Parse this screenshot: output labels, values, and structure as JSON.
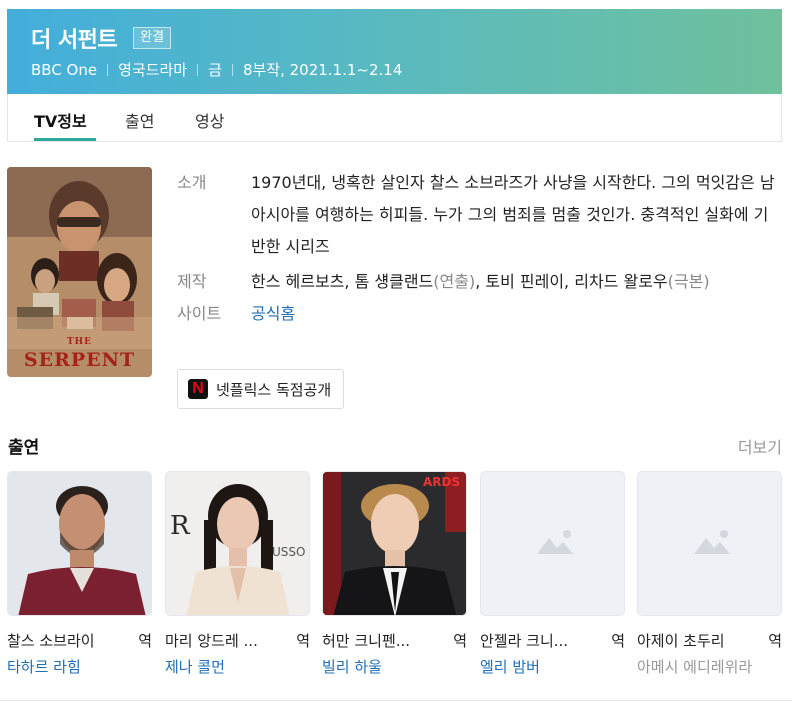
{
  "header": {
    "title": "더 서펀트",
    "badge": "완결",
    "meta": [
      "BBC One",
      "영국드라마",
      "금",
      "8부작, 2021.1.1~2.14"
    ]
  },
  "tabs": [
    {
      "label": "TV정보",
      "active": true
    },
    {
      "label": "출연",
      "active": false
    },
    {
      "label": "영상",
      "active": false
    }
  ],
  "poster": {
    "title_small": "THE",
    "title": "SERPENT"
  },
  "info": {
    "intro_label": "소개",
    "intro": "1970년대, 냉혹한 살인자 찰스 소브라즈가 사냥을 시작한다. 그의 먹잇감은 남아시아를 여행하는 히피들. 누가 그의 범죄를 멈출 것인가. 충격적인 실화에 기반한 시리즈",
    "production_label": "제작",
    "production_directors": "한스 헤르보츠, 톰 섕클랜드",
    "production_directors_role": "(연출)",
    "production_sep": ", ",
    "production_writers": "토비 핀레이, 리차드 왈로우",
    "production_writers_role": "(극본)",
    "site_label": "사이트",
    "site_link": "공식홈"
  },
  "netflix": {
    "logo": "N",
    "label": "넷플릭스 독점공개"
  },
  "cast_section": {
    "title": "출연",
    "more": "더보기"
  },
  "cast": [
    {
      "role": "찰스 소브라이",
      "role_suffix": "역",
      "name": "타하르 라힘",
      "has_photo": true,
      "linked": true
    },
    {
      "role": "마리 앙드레 ...",
      "role_suffix": "역",
      "name": "제나 콜먼",
      "has_photo": true,
      "linked": true
    },
    {
      "role": "허만 크니펜...",
      "role_suffix": "역",
      "name": "빌리 하울",
      "has_photo": true,
      "linked": true
    },
    {
      "role": "안젤라 크니...",
      "role_suffix": "역",
      "name": "엘리 밤버",
      "has_photo": false,
      "linked": true
    },
    {
      "role": "아제이 초두리",
      "role_suffix": "역",
      "name": "아메시 에디레위라",
      "has_photo": false,
      "linked": false
    }
  ],
  "colors": {
    "header_start": "#43aedb",
    "header_end": "#6fc19c",
    "link": "#1e6fb6",
    "tab_accent": "#2aaa9c",
    "netflix_red": "#e50914"
  }
}
